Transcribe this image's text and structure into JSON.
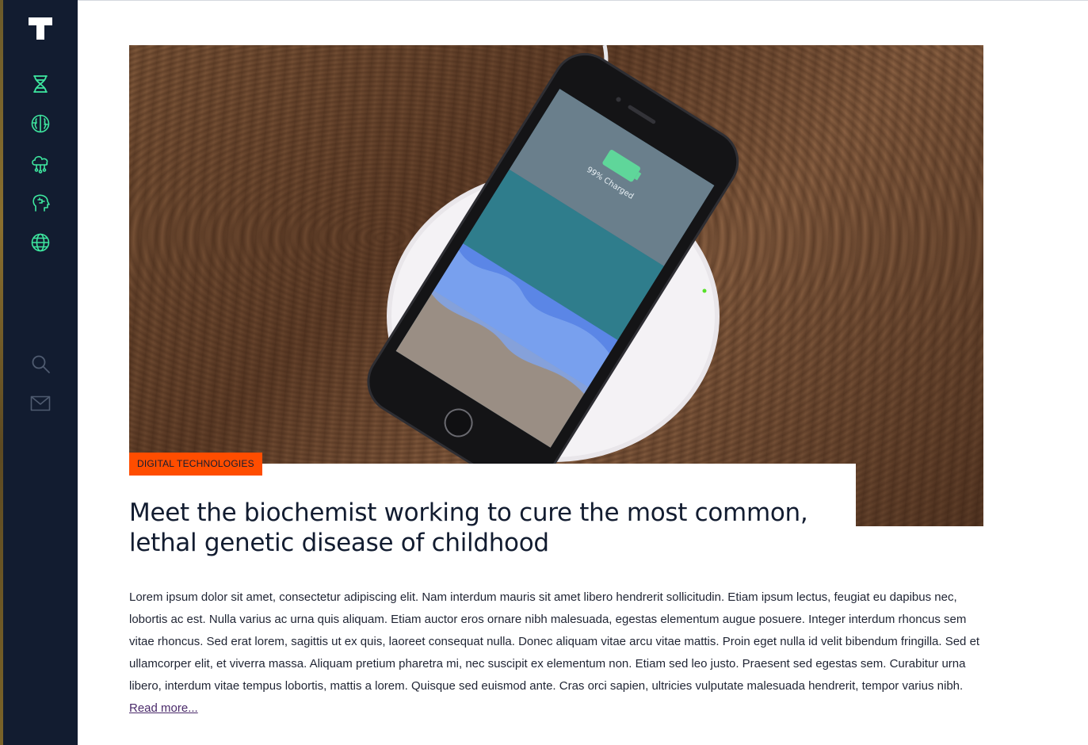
{
  "brand": {
    "logo_icon": "t-logo-icon"
  },
  "sidebar": {
    "items": [
      {
        "name": "dna",
        "icon": "dna-icon"
      },
      {
        "name": "brain",
        "icon": "brain-icon"
      },
      {
        "name": "cloud-network",
        "icon": "cloud-network-icon"
      },
      {
        "name": "head-mind",
        "icon": "head-mind-icon"
      },
      {
        "name": "globe",
        "icon": "globe-icon"
      }
    ],
    "utilities": [
      {
        "name": "search",
        "icon": "search-icon"
      },
      {
        "name": "mail",
        "icon": "mail-icon"
      }
    ]
  },
  "article": {
    "image_label": "99% Charged",
    "category": "DIGITAL TECHNOLOGIES",
    "title": "Meet the biochemist working to cure the most common, lethal genetic disease of childhood",
    "body": "Lorem ipsum dolor sit amet, consectetur adipiscing elit. Nam interdum mauris sit amet libero hendrerit sollicitudin. Etiam ipsum lectus, feugiat eu dapibus nec, lobortis ac est. Nulla varius ac urna quis aliquam. Etiam auctor eros ornare nibh malesuada, egestas elementum augue posuere. Integer interdum rhoncus sem vitae rhoncus. Sed erat lorem, sagittis ut ex quis, laoreet consequat nulla. Donec aliquam vitae arcu vitae mattis. Proin eget nulla id velit bibendum fringilla. Sed et ullamcorper elit, et viverra massa. Aliquam pretium pharetra mi, nec suscipit ex elementum non. Etiam sed leo justo. Praesent sed egestas sem. Curabitur urna libero, interdum vitae tempus lobortis, mattis a lorem. Quisque sed euismod ante. Cras orci sapien, ultricies vulputate malesuada hendrerit, tempor varius nibh.",
    "read_more": "Read more..."
  },
  "colors": {
    "sidebar_bg": "#121c30",
    "icon_accent": "#3ee8a0",
    "category_bg": "#ff4d00",
    "link": "#4a2a6a"
  }
}
